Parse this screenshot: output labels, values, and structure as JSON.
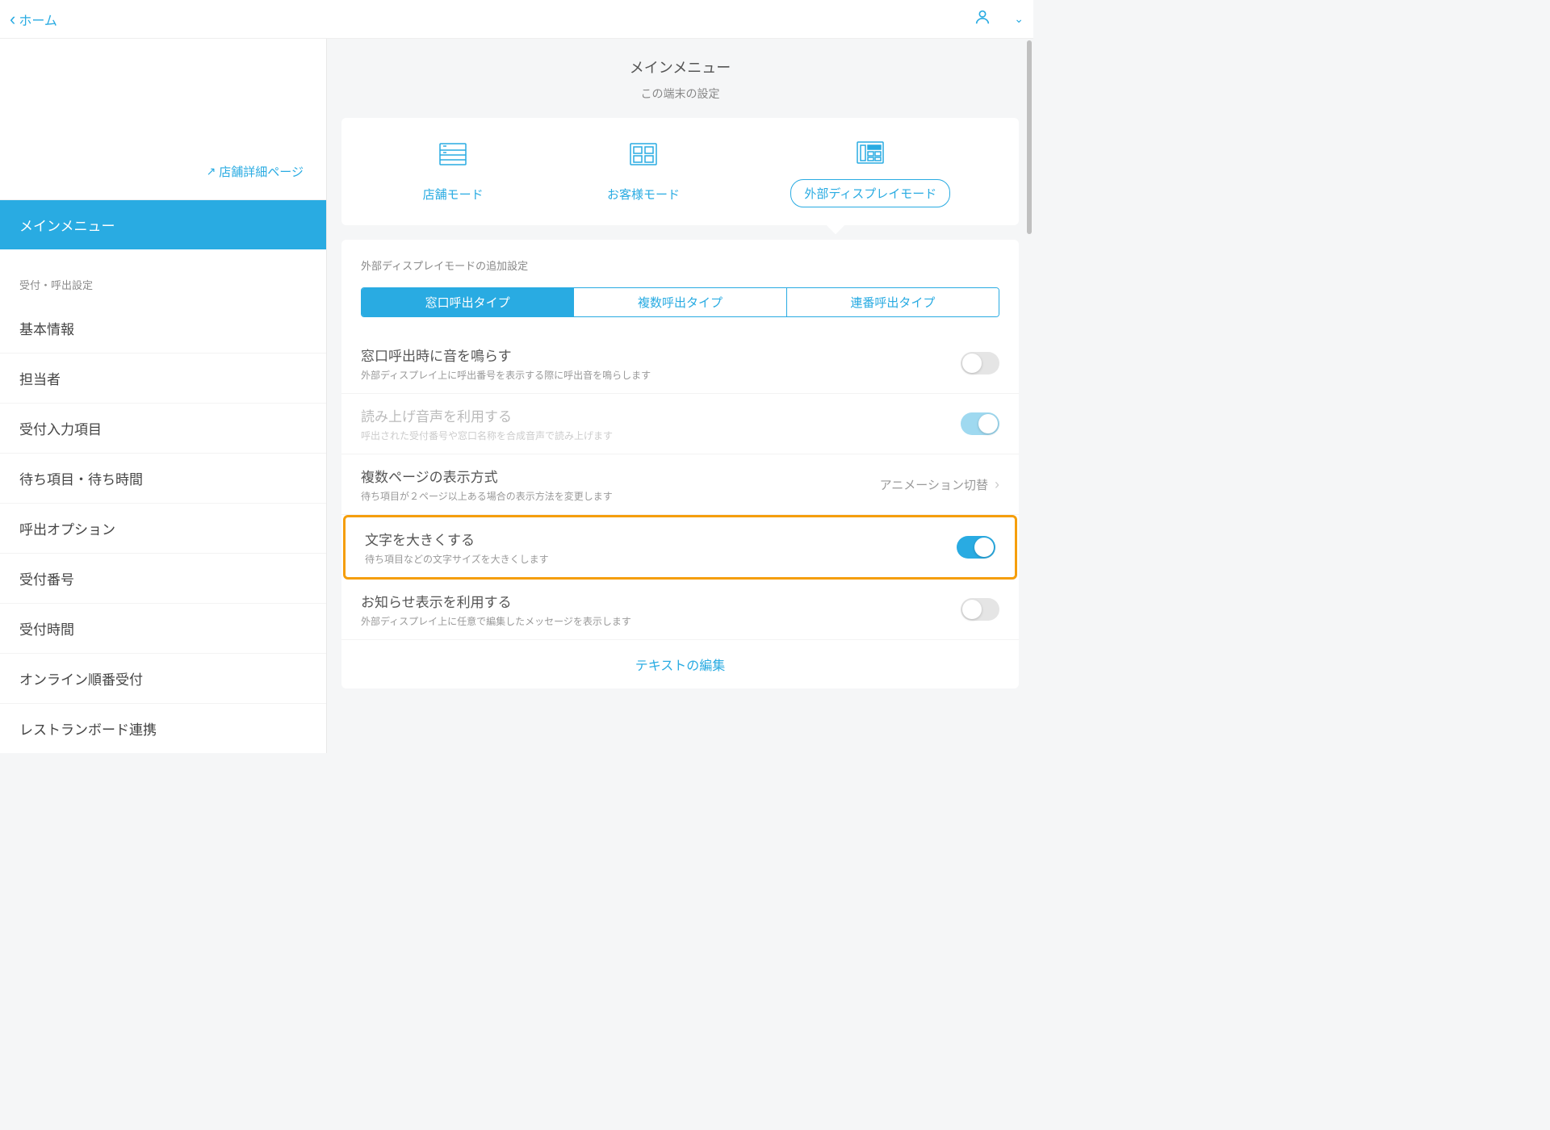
{
  "header": {
    "back_label": "ホーム"
  },
  "sidebar": {
    "detail_link": "店舗詳細ページ",
    "active_item": "メインメニュー",
    "section_label": "受付・呼出設定",
    "items": [
      "基本情報",
      "担当者",
      "受付入力項目",
      "待ち項目・待ち時間",
      "呼出オプション",
      "受付番号",
      "受付時間",
      "オンライン順番受付",
      "レストランボード連携"
    ]
  },
  "main": {
    "title": "メインメニュー",
    "subtitle": "この端末の設定",
    "mode_tabs": {
      "store": "店舗モード",
      "customer": "お客様モード",
      "external": "外部ディスプレイモード"
    },
    "settings_heading": "外部ディスプレイモードの追加設定",
    "segmented": {
      "counter": "窓口呼出タイプ",
      "multi": "複数呼出タイプ",
      "serial": "連番呼出タイプ"
    },
    "rows": {
      "sound": {
        "title": "窓口呼出時に音を鳴らす",
        "desc": "外部ディスプレイ上に呼出番号を表示する際に呼出音を鳴らします"
      },
      "tts": {
        "title": "読み上げ音声を利用する",
        "desc": "呼出された受付番号や窓口名称を合成音声で読み上げます"
      },
      "pages": {
        "title": "複数ページの表示方式",
        "desc": "待ち項目が２ページ以上ある場合の表示方法を変更します",
        "value": "アニメーション切替"
      },
      "largeText": {
        "title": "文字を大きくする",
        "desc": "待ち項目などの文字サイズを大きくします"
      },
      "notice": {
        "title": "お知らせ表示を利用する",
        "desc": "外部ディスプレイ上に任意で編集したメッセージを表示します"
      }
    },
    "edit_link": "テキストの編集"
  }
}
